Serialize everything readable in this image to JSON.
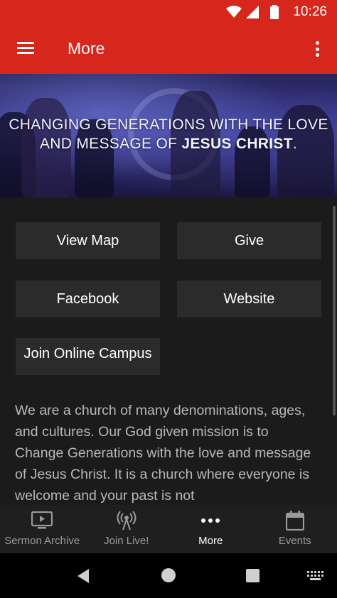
{
  "status_bar": {
    "time": "10:26"
  },
  "app_bar": {
    "title": "More"
  },
  "hero": {
    "line1": "CHANGING GENERATIONS WITH THE LOVE",
    "line2_prefix": "AND MESSAGE OF ",
    "line2_bold": "JESUS CHRIST",
    "line2_suffix": "."
  },
  "buttons": {
    "view_map": "View Map",
    "give": "Give",
    "facebook": "Facebook",
    "website": "Website",
    "join_online_campus": "Join Online Campus"
  },
  "description": "We are a church of many denominations, ages, and cultures. Our God given mission is to Change Generations with the love and message of Jesus Christ. It is a church where everyone is welcome and your past is not",
  "bottom_nav": {
    "items": [
      {
        "label": "Sermon Archive",
        "icon": "tv-play-icon"
      },
      {
        "label": "Join Live!",
        "icon": "broadcast-icon"
      },
      {
        "label": "More",
        "icon": "more-dots-icon"
      },
      {
        "label": "Events",
        "icon": "calendar-icon"
      }
    ],
    "active_index": 2
  },
  "colors": {
    "primary": "#d7271d",
    "background": "#1b1b1b",
    "button": "#2b2b2b"
  }
}
